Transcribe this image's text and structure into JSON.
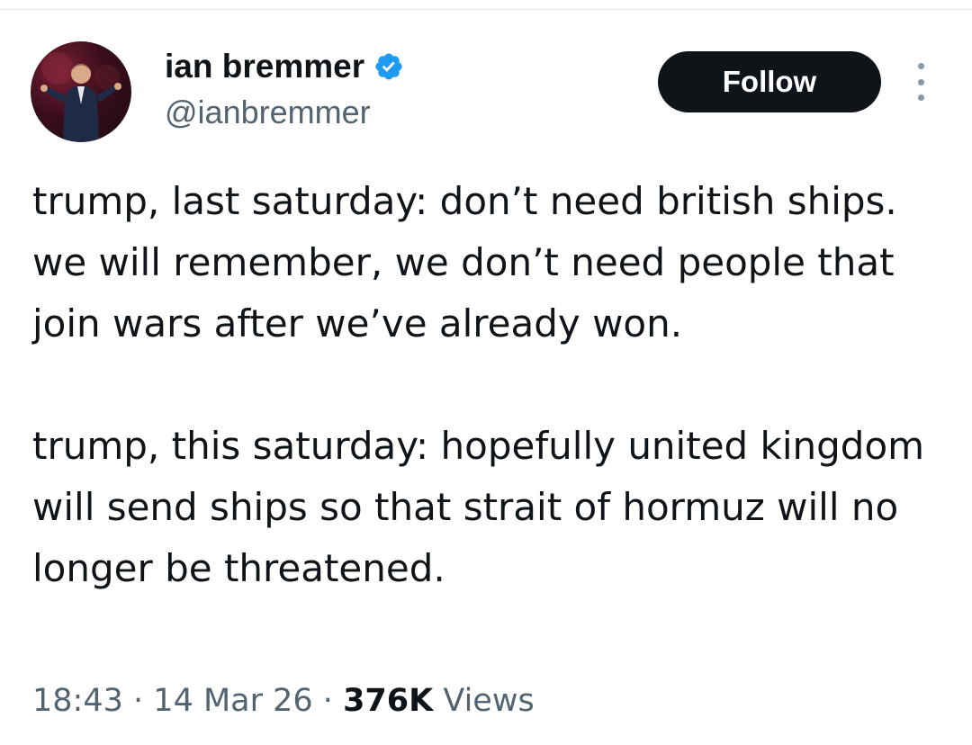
{
  "author": {
    "display_name": "ian bremmer",
    "handle": "@ianbremmer",
    "verified": true
  },
  "actions": {
    "follow_label": "Follow"
  },
  "tweet": {
    "paragraphs": [
      "trump, last saturday: don’t need british ships. we will remember, we don’t need people that join wars after we’ve already won.",
      "trump, this saturday: hopefully united kingdom will send ships so that strait of hormuz will no longer be threatened."
    ]
  },
  "meta": {
    "time": "18:43",
    "separator": "·",
    "date": "14 Mar 26",
    "views_count": "376K",
    "views_label": "Views"
  },
  "colors": {
    "text": "#0f1419",
    "secondary_text": "#536471",
    "follow_button_bg": "#0f1419",
    "verified_badge": "#1d9bf0"
  },
  "icons": {
    "verified": "verified-badge-icon",
    "more": "more-options-icon"
  }
}
